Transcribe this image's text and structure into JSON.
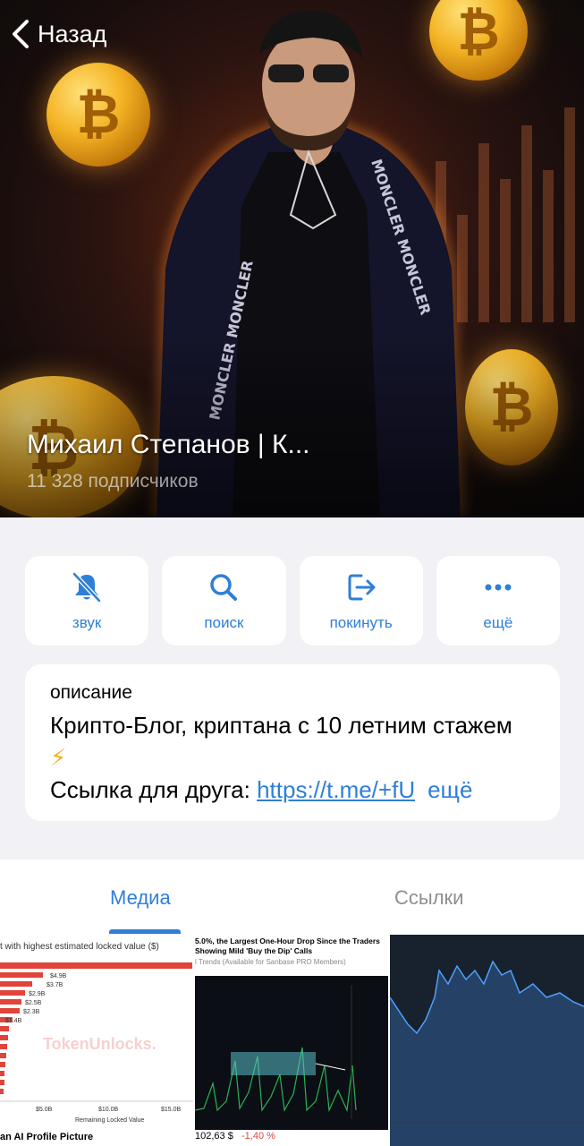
{
  "nav": {
    "back_label": "Назад"
  },
  "channel": {
    "title": "Михаил Степанов | К...",
    "subscribers": "11 328 подписчиков"
  },
  "actions": [
    {
      "label": "звук",
      "icon": "bell-slash-icon"
    },
    {
      "label": "поиск",
      "icon": "search-icon"
    },
    {
      "label": "покинуть",
      "icon": "leave-icon"
    },
    {
      "label": "ещё",
      "icon": "more-dots-icon"
    }
  ],
  "description": {
    "label": "описание",
    "text": "Крипто-Блог, криптана с 10 летним стажем",
    "emoji": "⚡",
    "link_prefix": "Ссылка для друга: ",
    "link": "https://t.me/+fU",
    "more": "ещё"
  },
  "tabs": [
    {
      "label": "Медиа",
      "active": true
    },
    {
      "label": "Ссылки",
      "active": false
    }
  ],
  "media": [
    {
      "title": "t with highest estimated locked value ($)",
      "bar_labels": [
        "$4.9B",
        "$3.7B",
        "$2.9B",
        "$2.5B",
        "$2.3B",
        "$1.4B"
      ],
      "watermark": "TokenUnlocks.",
      "x_ticks": [
        "$5.0B",
        "$10.0B",
        "$15.0B"
      ],
      "x_label": "Remaining Locked Value",
      "caption": "an AI Profile Picture"
    },
    {
      "title": "5.0%, the Largest One-Hour Drop Since the Traders Showing Mild 'Buy the Dip' Calls",
      "subtitle": "l Trends (Available for Sanbase PRO Members)",
      "price": "102,63 $",
      "change": "-1,40 %"
    },
    {
      "title": ""
    }
  ],
  "colors": {
    "accent": "#2f7fd8",
    "background": "#f1f1f6",
    "muted": "#8e8e93",
    "negative": "#e0443a"
  }
}
